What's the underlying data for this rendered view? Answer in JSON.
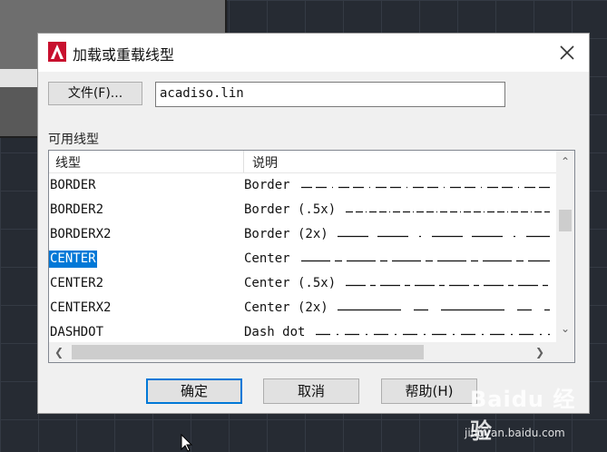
{
  "dialog": {
    "title": "加载或重载线型",
    "file_button_label": "文件(F)...",
    "file_value": "acadiso.lin",
    "available_label": "可用线型"
  },
  "list": {
    "headers": [
      "线型",
      "说明"
    ],
    "rows": [
      {
        "name": "BORDER",
        "desc": "Border"
      },
      {
        "name": "BORDER2",
        "desc": "Border (.5x)"
      },
      {
        "name": "BORDERX2",
        "desc": "Border (2x)"
      },
      {
        "name": "CENTER",
        "desc": "Center",
        "selected": true
      },
      {
        "name": "CENTER2",
        "desc": "Center (.5x)"
      },
      {
        "name": "CENTERX2",
        "desc": "Center (2x)"
      },
      {
        "name": "DASHDOT",
        "desc": "Dash dot"
      }
    ]
  },
  "buttons": {
    "ok": "确定",
    "cancel": "取消",
    "help": "帮助(H)"
  },
  "watermark": {
    "logo": "Baidu 经验",
    "url": "jingyan.baidu.com"
  },
  "colors": {
    "selection": "#0078d7",
    "app_icon": "#c8102e"
  },
  "icons": [
    "autocad-icon",
    "close-icon",
    "scroll-up-icon",
    "scroll-down-icon",
    "scroll-left-icon",
    "scroll-right-icon",
    "mouse-cursor-icon"
  ]
}
